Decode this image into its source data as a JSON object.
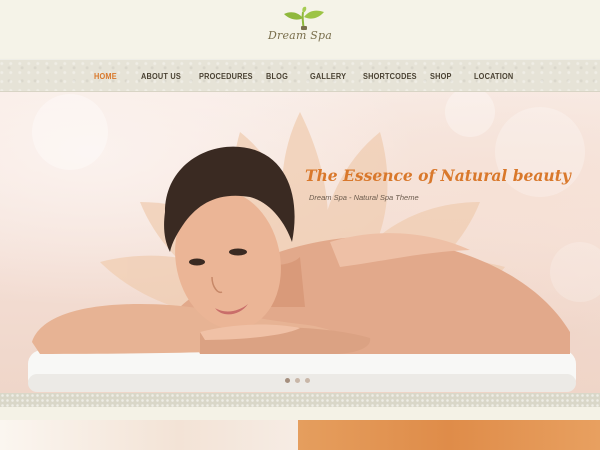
{
  "brand": {
    "logo_text": "Dream Spa",
    "logo_icon": "leaf-logo-icon",
    "colors": {
      "accent": "#d9782b",
      "leaf": "#8fb83c",
      "nav_text": "#4a4233"
    }
  },
  "nav": {
    "items": [
      {
        "label": "HOME",
        "active": true
      },
      {
        "label": "ABOUT US",
        "active": false
      },
      {
        "label": "PROCEDURES",
        "active": false
      },
      {
        "label": "BLOG",
        "active": false
      },
      {
        "label": "GALLERY",
        "active": false
      },
      {
        "label": "SHORTCODES",
        "active": false
      },
      {
        "label": "SHOP",
        "active": false
      },
      {
        "label": "LOCATION",
        "active": false
      }
    ]
  },
  "hero": {
    "title": "The Essence of Natural beauty",
    "subtitle": "Dream Spa - Natural Spa Theme",
    "slides": {
      "count": 3,
      "active_index": 0
    }
  }
}
